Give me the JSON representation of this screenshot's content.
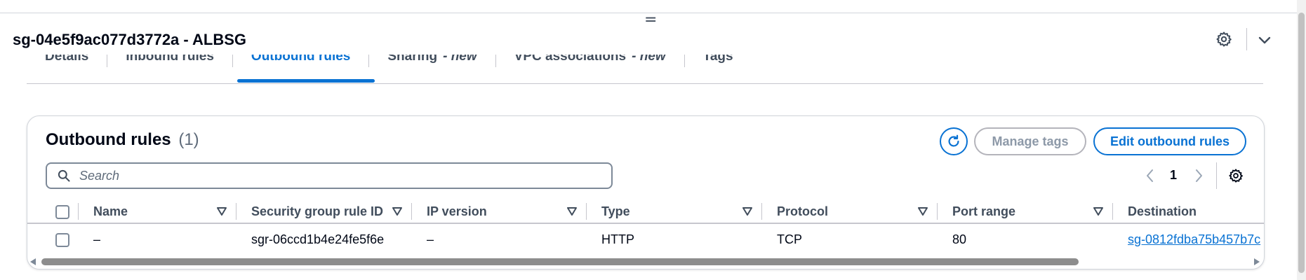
{
  "panel": {
    "title": "sg-04e5f9ac077d3772a - ALBSG",
    "drag_glyph": "="
  },
  "tabs": [
    {
      "label": "Details",
      "new": ""
    },
    {
      "label": "Inbound rules",
      "new": ""
    },
    {
      "label": "Outbound rules",
      "new": ""
    },
    {
      "label": "Sharing",
      "new": "- new"
    },
    {
      "label": "VPC associations",
      "new": "- new"
    },
    {
      "label": "Tags",
      "new": ""
    }
  ],
  "active_tab": "Outbound rules",
  "card": {
    "title": "Outbound rules",
    "count": "(1)",
    "manage_tags_label": "Manage tags",
    "edit_label": "Edit outbound rules",
    "search_placeholder": "Search",
    "page_number": "1"
  },
  "table": {
    "columns": [
      "Name",
      "Security group rule ID",
      "IP version",
      "Type",
      "Protocol",
      "Port range",
      "Destination"
    ],
    "rows": [
      {
        "name": "–",
        "rule_id": "sgr-06ccd1b4e24fe5f6e",
        "ip_version": "–",
        "type": "HTTP",
        "protocol": "TCP",
        "port_range": "80",
        "destination": "sg-0812fdba75b457b7c"
      }
    ]
  },
  "icons": {
    "header_settings": "gear-icon",
    "header_collapse": "chevron-down-icon",
    "refresh": "refresh-icon",
    "search": "search-icon",
    "pager_prev": "chevron-left-icon",
    "pager_next": "chevron-right-icon",
    "preferences": "gear-icon",
    "sort": "sort-caret-icon"
  },
  "colors": {
    "accent": "#0972d3",
    "text": "#000716",
    "muted": "#414d5c",
    "disabled": "#8d99a8",
    "border": "#c6c6cd"
  }
}
